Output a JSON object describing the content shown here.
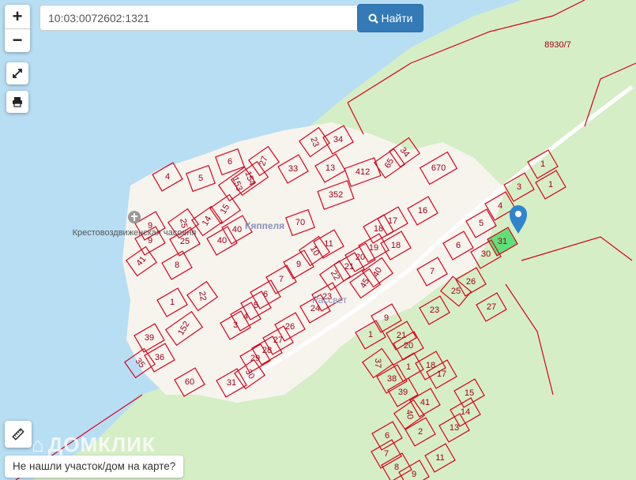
{
  "search": {
    "value": "10:03:0072602:1321",
    "button_label": "Найти",
    "icon": "search-icon"
  },
  "controls": {
    "zoom_in": "+",
    "zoom_out": "−",
    "fullscreen_icon": "expand-icon",
    "print_icon": "print-icon",
    "ruler_icon": "ruler-icon"
  },
  "hint": {
    "label": "Не нашли участок/дом на карте?"
  },
  "watermark": "ДОМКЛИК",
  "map": {
    "colors": {
      "water": "#b8def4",
      "forest": "#d6eec6",
      "settlement": "#f7f4ee",
      "parcel_border": "#d9001b",
      "selected_parcel": "#5fe07a",
      "pin": "#2f84cc"
    },
    "poi": {
      "chapel": "Крестовоздвиженская часовня",
      "village1": "Кяппеля",
      "village2": "Рассвет"
    },
    "selected_parcel": "31",
    "parcels": [
      "8930/7",
      "5",
      "6",
      "153",
      "154",
      "27",
      "33",
      "23",
      "34",
      "13",
      "412",
      "65",
      "34",
      "670",
      "4",
      "15",
      "14",
      "25",
      "25",
      "40",
      "40",
      "9",
      "9",
      "41",
      "8",
      "70",
      "352",
      "11",
      "10",
      "9",
      "7",
      "6",
      "5",
      "4",
      "3",
      "18",
      "17",
      "19",
      "18",
      "20",
      "21",
      "22",
      "45",
      "40",
      "23",
      "24",
      "26",
      "27",
      "28",
      "29",
      "30",
      "31",
      "1",
      "22",
      "152",
      "39",
      "36",
      "35",
      "60",
      "1",
      "3",
      "1",
      "4",
      "5",
      "31",
      "30",
      "6",
      "7",
      "26",
      "25",
      "27",
      "23",
      "9",
      "1",
      "21",
      "20",
      "37",
      "1",
      "18",
      "17",
      "38",
      "39",
      "41",
      "40",
      "2",
      "15",
      "14",
      "13",
      "6",
      "7",
      "11",
      "8",
      "9",
      "16"
    ]
  }
}
